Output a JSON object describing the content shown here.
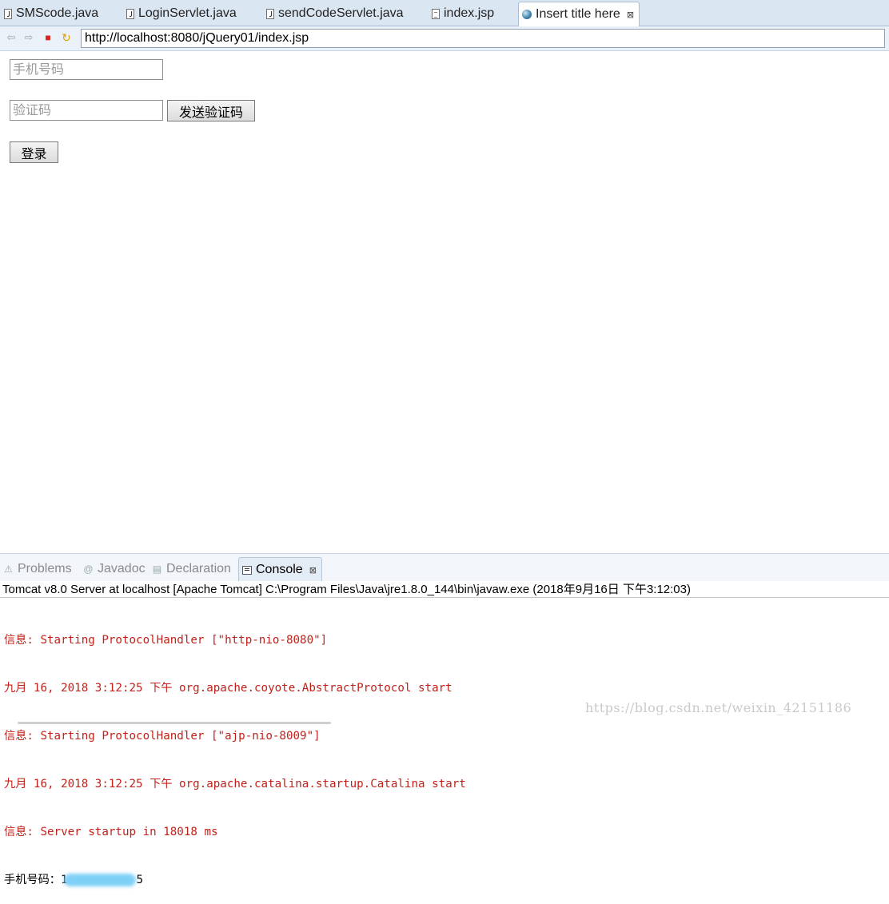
{
  "editor_tabs": [
    {
      "label": "SMScode.java",
      "icon": "java-file-icon"
    },
    {
      "label": "LoginServlet.java",
      "icon": "java-file-icon"
    },
    {
      "label": "sendCodeServlet.java",
      "icon": "java-file-icon"
    },
    {
      "label": "index.jsp",
      "icon": "jsp-file-icon"
    },
    {
      "label": "Insert title here",
      "icon": "globe-icon",
      "active": true,
      "close": "⊠"
    }
  ],
  "browser": {
    "url": "http://localhost:8080/jQuery01/index.jsp"
  },
  "form": {
    "phone_placeholder": "手机号码",
    "code_placeholder": "验证码",
    "send_code_label": "发送验证码",
    "login_label": "登录"
  },
  "views": {
    "tabs": [
      {
        "label": "Problems",
        "icon": "problems-icon"
      },
      {
        "label": "Javadoc",
        "icon": "at-icon"
      },
      {
        "label": "Declaration",
        "icon": "declaration-icon"
      },
      {
        "label": "Console",
        "icon": "console-icon",
        "active": true,
        "close": "⊠"
      }
    ]
  },
  "console": {
    "header": "Tomcat v8.0 Server at localhost [Apache Tomcat] C:\\Program Files\\Java\\jre1.8.0_144\\bin\\javaw.exe (2018年9月16日 下午3:12:03)",
    "lines": [
      {
        "text": "信息: Starting ProtocolHandler [\"http-nio-8080\"]",
        "color": "#c2211b"
      },
      {
        "text": "九月 16, 2018 3:12:25 下午 org.apache.coyote.AbstractProtocol start",
        "color": "#c2211b"
      },
      {
        "text": "信息: Starting ProtocolHandler [\"ajp-nio-8009\"]",
        "color": "#c2211b"
      },
      {
        "text": "九月 16, 2018 3:12:25 下午 org.apache.catalina.startup.Catalina start",
        "color": "#c2211b"
      },
      {
        "text": "信息: Server startup in 18018 ms",
        "color": "#c2211b"
      }
    ],
    "last_line_prefix": "手机号码：1",
    "last_line_suffix": "5"
  },
  "watermark": "https://blog.csdn.net/weixin_42151186"
}
